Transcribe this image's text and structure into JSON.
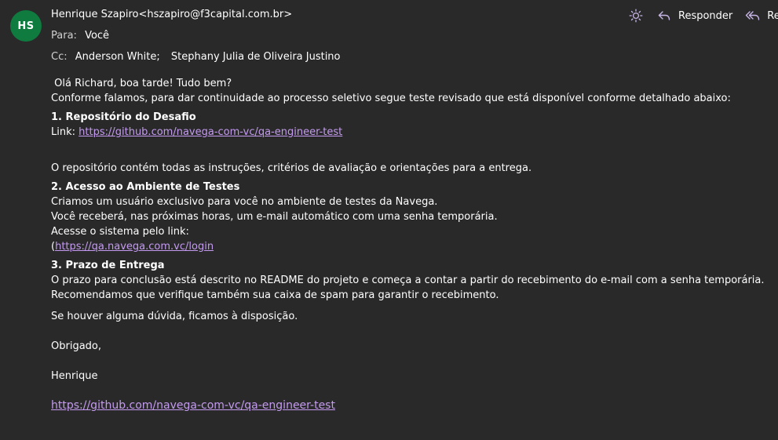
{
  "sender": {
    "initials": "HS",
    "from_line": "Henrique Szapiro<hszapiro@f3capital.com.br>"
  },
  "recipients": {
    "to_label": "Para:",
    "to_value": "Você",
    "cc_label": "Cc:",
    "cc": [
      "Anderson White;",
      "Stephany Julia de Oliveira Justino"
    ]
  },
  "actions": {
    "reply_label": "Responder",
    "reply_all_label": "Res",
    "icons": [
      "sun-icon",
      "reply-icon",
      "reply-all-icon"
    ]
  },
  "message": {
    "greeting": " Olá Richard, boa tarde! Tudo bem?",
    "intro": "Conforme falamos, para dar continuidade ao processo seletivo segue teste revisado que está disponível conforme detalhado abaixo:",
    "section1_title": "1. Repositório do Desafio",
    "section1_link_prefix": "Link: ",
    "section1_link": "https://github.com/navega-com-vc/qa-engineer-test",
    "section1_note": "O repositório contém todas as instruções, critérios de avaliação e orientações para a entrega.",
    "section2_title": "2. Acesso ao Ambiente de Testes",
    "section2_line1": "Criamos um usuário exclusivo para você no ambiente de testes da Navega.",
    "section2_line2": "Você receberá, nas próximas horas, um e-mail automático com uma senha temporária.",
    "section2_line3": "Acesse o sistema pelo link:",
    "section2_link_prefix": "(",
    "section2_link": "https://qa.navega.com.vc/login",
    "section3_title": "3. Prazo de Entrega",
    "section3_line1": "O prazo para conclusão está descrito no README do projeto e começa a contar a partir do recebimento do e-mail com a senha temporária.",
    "section3_line2": "Recomendamos que verifique também sua caixa de spam para garantir o recebimento.",
    "closing1": "Se houver alguma dúvida, ficamos à disposição.",
    "closing2": "Obrigado,",
    "signature": "Henrique",
    "footer_link": "https://github.com/navega-com-vc/qa-engineer-test"
  },
  "colors": {
    "background": "#292929",
    "avatar": "#0f7b3f",
    "link": "#c49bf0",
    "icon": "#c8b6e8"
  }
}
